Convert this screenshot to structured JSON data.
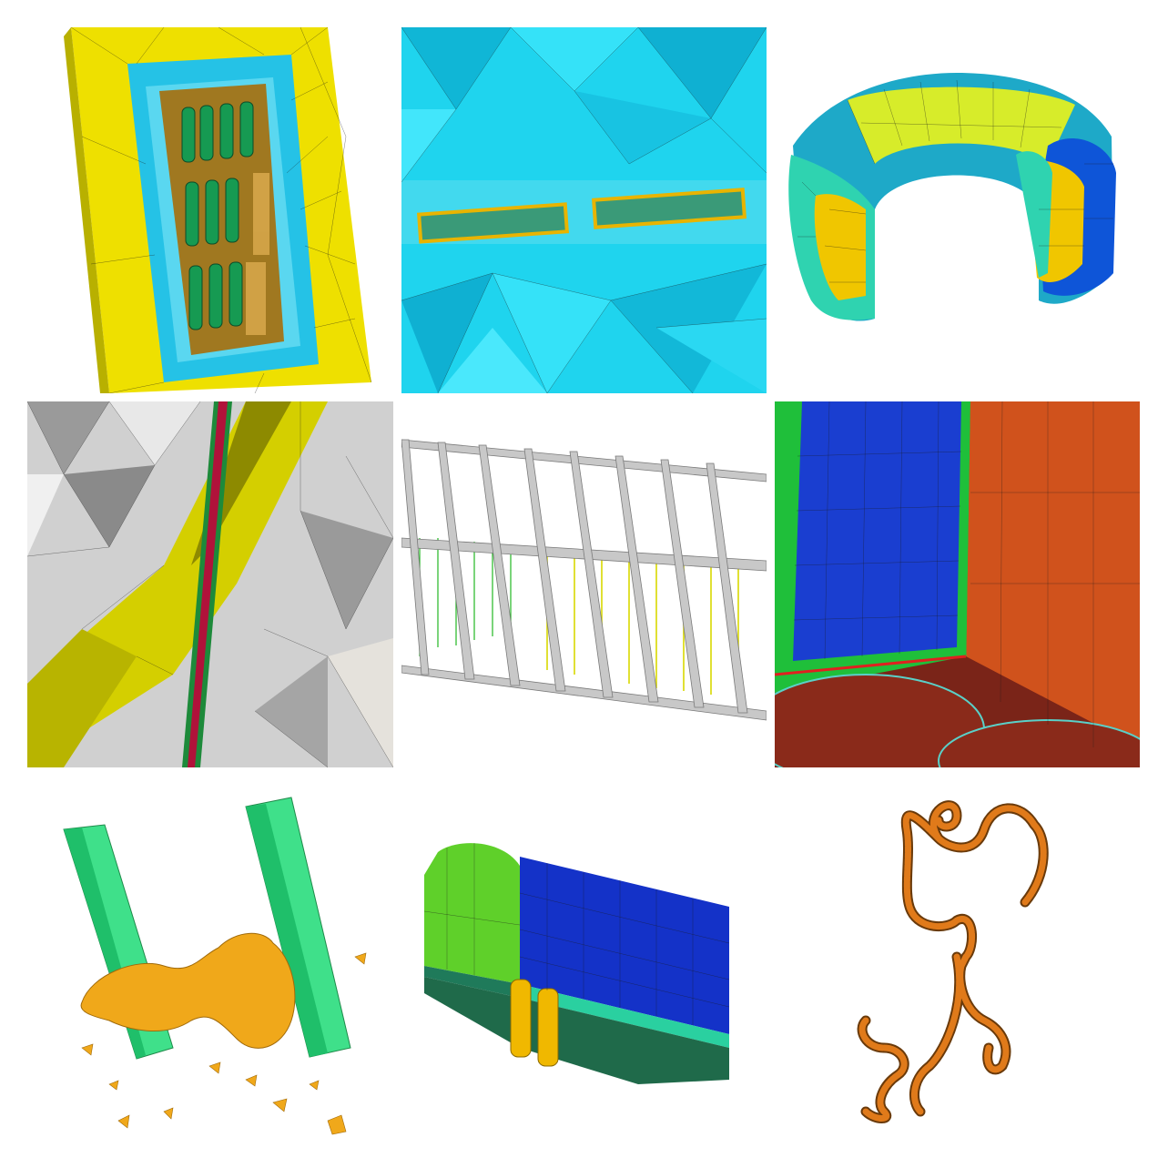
{
  "gallery": {
    "tiles": [
      {
        "id": "t1",
        "subject": "yellow-block-with-green-cylinder-array-mesh",
        "colors": [
          "#f2e800",
          "#2cc7e8",
          "#b5892a",
          "#1fa55a"
        ]
      },
      {
        "id": "t2",
        "subject": "cyan-tetrahedral-mesh-with-two-embedded-strips",
        "colors": [
          "#1fd6f0",
          "#0fb8d8",
          "#e8b400",
          "#2e8a6a"
        ]
      },
      {
        "id": "t3",
        "subject": "torus-segment-hex-mesh",
        "colors": [
          "#d8ee2a",
          "#2fd3b0",
          "#0b4fd6",
          "#f0c400"
        ]
      },
      {
        "id": "t4",
        "subject": "grey-tet-mesh-with-yellow-band-and-fracture",
        "colors": [
          "#c9c9c9",
          "#d4cf00",
          "#b0123a",
          "#1d8a3a"
        ]
      },
      {
        "id": "t5",
        "subject": "grey-lattice-frame-with-vertical-rods",
        "colors": [
          "#c8c8c8",
          "#e0e000",
          "#22b822"
        ]
      },
      {
        "id": "t6",
        "subject": "blue-orange-layered-block-mesh",
        "colors": [
          "#1a3ed0",
          "#d0521c",
          "#1fbf3a",
          "#8a2a1a"
        ]
      },
      {
        "id": "t7",
        "subject": "two-green-columns-with-orange-blob",
        "colors": [
          "#3fe08a",
          "#f0a81a"
        ]
      },
      {
        "id": "t8",
        "subject": "box-mesh-with-two-pipes",
        "colors": [
          "#1432c8",
          "#5fd02a",
          "#1f7a5a",
          "#f0b800"
        ]
      },
      {
        "id": "t9",
        "subject": "orange-tube-curve",
        "colors": [
          "#e07a1a",
          "#2a1a08"
        ]
      }
    ]
  }
}
